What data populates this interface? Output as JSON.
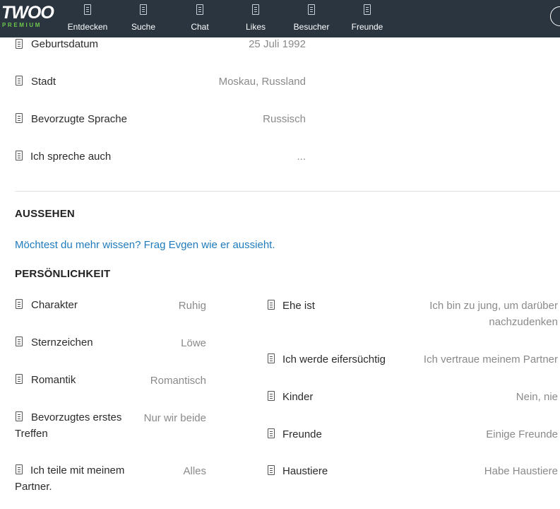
{
  "header": {
    "logo_text": "TWOO",
    "logo_sub": "PREMIUM",
    "nav": [
      {
        "label": "Entdecken",
        "icon": "discover-icon"
      },
      {
        "label": "Suche",
        "icon": "search-icon"
      },
      {
        "label": "Chat",
        "icon": "chat-icon"
      },
      {
        "label": "Likes",
        "icon": "likes-icon"
      },
      {
        "label": "Besucher",
        "icon": "visitors-icon"
      },
      {
        "label": "Freunde",
        "icon": "friends-icon"
      }
    ]
  },
  "basics": [
    {
      "label": "Geburtsdatum",
      "value": "25 Juli 1992"
    },
    {
      "label": "Stadt",
      "value": "Moskau, Russland"
    },
    {
      "label": "Bevorzugte Sprache",
      "value": "Russisch"
    },
    {
      "label": "Ich spreche auch",
      "value": "..."
    }
  ],
  "appearance": {
    "title": "AUSSEHEN",
    "link": "Möchtest du mehr wissen? Frag Evgen wie er aussieht."
  },
  "personality": {
    "title": "PERSÖNLICHKEIT",
    "left": [
      {
        "label": "Charakter",
        "value": "Ruhig"
      },
      {
        "label": "Sternzeichen",
        "value": "Löwe"
      },
      {
        "label": "Romantik",
        "value": "Romantisch"
      },
      {
        "label_line1": "Bevorzugtes erstes",
        "label_line2": "Treffen",
        "value": "Nur wir beide"
      },
      {
        "label_line1": "Ich teile mit meinem",
        "label_line2": "Partner.",
        "value": "Alles"
      }
    ],
    "right": [
      {
        "label": "Ehe ist",
        "value_line1": "Ich bin zu jung, um darüber",
        "value_line2": "nachzudenken"
      },
      {
        "label": "Ich werde eifersüchtig",
        "value": "Ich vertraue meinem Partner"
      },
      {
        "label": "Kinder",
        "value": "Nein, nie"
      },
      {
        "label": "Freunde",
        "value": "Einige Freunde"
      },
      {
        "label": "Haustiere",
        "value": "Habe Haustiere"
      }
    ]
  }
}
